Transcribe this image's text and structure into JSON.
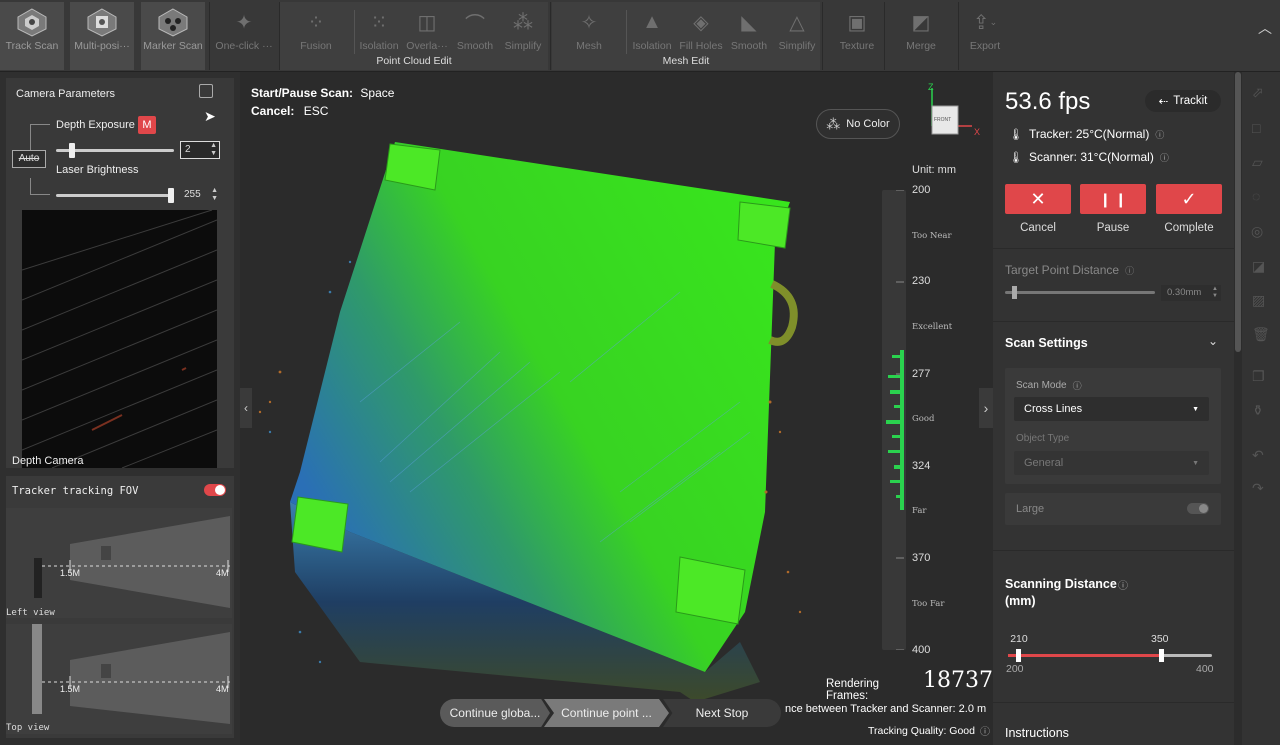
{
  "toolbar": {
    "track_scan": "Track Scan",
    "multi_pos": "Multi-posi···",
    "marker_scan": "Marker Scan",
    "one_click": "One-click ···",
    "fusion": "Fusion",
    "isolation1": "Isolation",
    "overlap": "Overla···",
    "smooth1": "Smooth",
    "simplify1": "Simplify",
    "point_cloud_edit": "Point Cloud Edit",
    "mesh": "Mesh",
    "isolation2": "Isolation",
    "fill_holes": "Fill Holes",
    "smooth2": "Smooth",
    "simplify2": "Simplify",
    "mesh_edit": "Mesh Edit",
    "texture": "Texture",
    "merge": "Merge",
    "export": "Export"
  },
  "camera": {
    "title": "Camera Parameters",
    "depth_exposure": "Depth Exposure",
    "mode_badge": "M",
    "exposure_value": "2",
    "auto_label": "Auto",
    "laser_brightness": "Laser Brightness",
    "laser_value": "255",
    "exposure_level": 0.12,
    "laser_level": 1.0,
    "depth_camera": "Depth Camera"
  },
  "fov": {
    "title": "Tracker tracking FOV",
    "near": "1.5M",
    "far": "4M",
    "left_view": "Left view",
    "top_view": "Top view"
  },
  "viewport": {
    "start_pause_label": "Start/Pause Scan:",
    "start_pause_key": "Space",
    "cancel_label": "Cancel:",
    "cancel_key": "ESC",
    "no_color": "No Color",
    "cube_label": "FRONT",
    "axis_z": "Z",
    "axis_x": "X",
    "unit": "Unit: mm",
    "scale_values": [
      "200",
      "230",
      "277",
      "324",
      "370",
      "400"
    ],
    "scale_words": [
      "Too Near",
      "Excellent",
      "Good",
      "Far",
      "Too Far"
    ],
    "rendering_label": "Rendering Frames:",
    "rendering_value": "18737",
    "distance_text": "nce between Tracker and Scanner: 2.0 m",
    "tracking_quality": "Tracking Quality: Good",
    "steps": [
      "Continue globa...",
      "Continue point ...",
      "Next Stop"
    ]
  },
  "right": {
    "fps": "53.6 fps",
    "trackit": "Trackit",
    "tracker_temp": "Tracker: 25°C(Normal)",
    "scanner_temp": "Scanner: 31°C(Normal)",
    "cancel": "Cancel",
    "pause": "Pause",
    "complete": "Complete",
    "target_point_distance": "Target Point Distance",
    "tpd_value": "0.30mm",
    "tpd_level": 0.05,
    "scan_settings": "Scan Settings",
    "scan_mode_label": "Scan Mode",
    "scan_mode_value": "Cross Lines",
    "object_type_label": "Object Type",
    "object_type_value": "General",
    "large": "Large",
    "scanning_distance": "Scanning Distance",
    "scanning_distance_unit": "(mm)",
    "range_low": "210",
    "range_high": "350",
    "range_min": "200",
    "range_max": "400",
    "instructions": "Instructions"
  },
  "colors": {
    "accent_red": "#e0474a",
    "scan_green": "#33e81a",
    "scan_blue": "#1f6fb8"
  }
}
